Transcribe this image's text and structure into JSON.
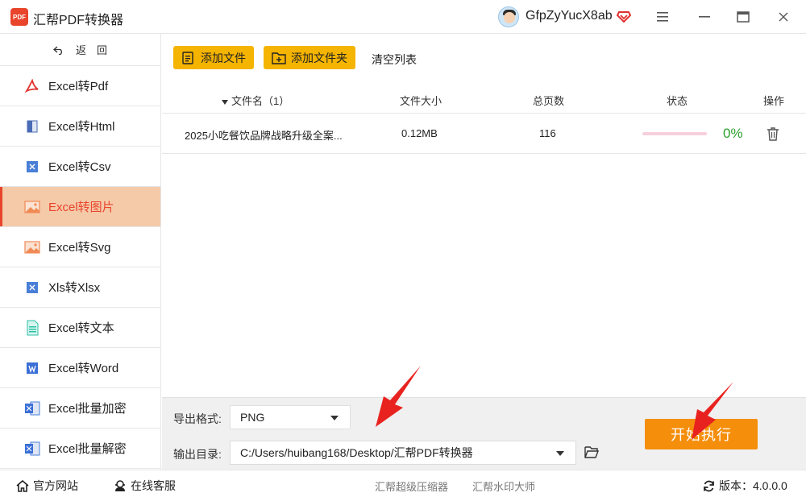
{
  "app": {
    "logo_text": "PDF",
    "title": "汇帮PDF转换器",
    "username": "GfpZyYucX8ab"
  },
  "sidebar": {
    "back_label": "返　回",
    "items": [
      {
        "label": "Excel转Pdf",
        "icon": "pdf-icon"
      },
      {
        "label": "Excel转Html",
        "icon": "html-icon"
      },
      {
        "label": "Excel转Csv",
        "icon": "csv-icon"
      },
      {
        "label": "Excel转图片",
        "icon": "image-icon",
        "active": true
      },
      {
        "label": "Excel转Svg",
        "icon": "image-icon"
      },
      {
        "label": "Xls转Xlsx",
        "icon": "excel-icon"
      },
      {
        "label": "Excel转文本",
        "icon": "text-icon"
      },
      {
        "label": "Excel转Word",
        "icon": "word-icon"
      },
      {
        "label": "Excel批量加密",
        "icon": "excel-lock-icon"
      },
      {
        "label": "Excel批量解密",
        "icon": "excel-unlock-icon"
      }
    ]
  },
  "toolbar": {
    "add_file": "添加文件",
    "add_folder": "添加文件夹",
    "clear_list": "清空列表"
  },
  "table": {
    "headers": {
      "name": "文件名（1）",
      "size": "文件大小",
      "pages": "总页数",
      "status": "状态",
      "action": "操作"
    },
    "rows": [
      {
        "name": "2025小吃餐饮品牌战略升级全案...",
        "size": "0.12MB",
        "pages": "116",
        "progress_pct": "0%",
        "progress": 0
      }
    ]
  },
  "settings": {
    "format_label": "导出格式:",
    "format_value": "PNG",
    "dir_label": "输出目录:",
    "dir_value": "C:/Users/huibang168/Desktop/汇帮PDF转换器",
    "start_button": "开始执行"
  },
  "statusbar": {
    "website": "官方网站",
    "support": "在线客服",
    "link1": "汇帮超级压缩器",
    "link2": "汇帮水印大师",
    "version": "版本：4.0.0.0"
  },
  "colors": {
    "accent_orange": "#f58e0b",
    "button_yellow": "#f5b400",
    "active_bg": "#f5caa9",
    "active_text": "#e8452c",
    "progress_green": "#2ba02b",
    "arrow_red": "#e8231f"
  }
}
